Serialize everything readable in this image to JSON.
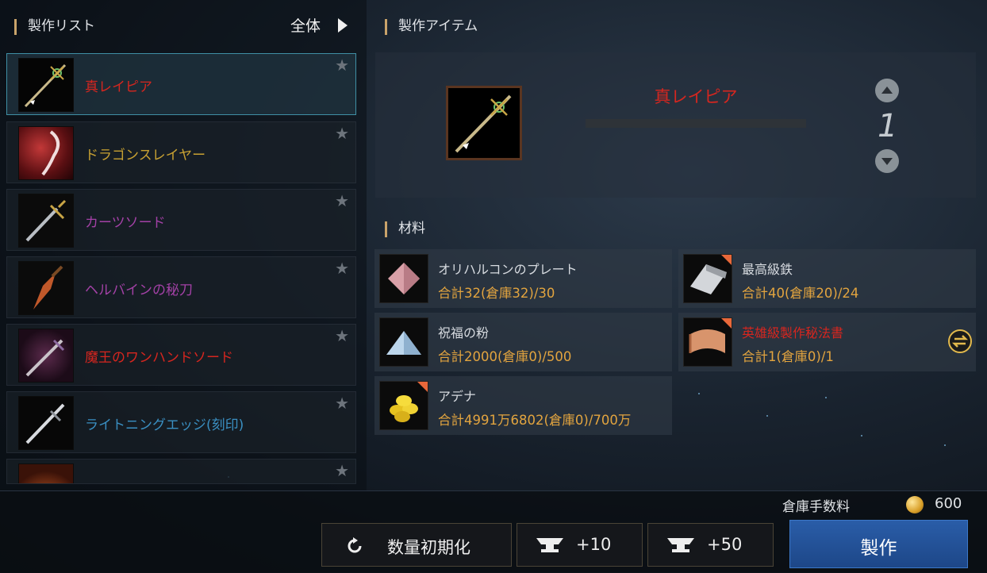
{
  "craft_list": {
    "title": "製作リスト",
    "filter": "全体",
    "items": [
      {
        "name": "真レイピア",
        "color": "#d6261f",
        "selected": true
      },
      {
        "name": "ドラゴンスレイヤー",
        "color": "#c8a132"
      },
      {
        "name": "カーツソード",
        "color": "#a341a6"
      },
      {
        "name": "ヘルバインの秘刀",
        "color": "#a341a6"
      },
      {
        "name": "魔王のワンハンドソード",
        "color": "#d6261f"
      },
      {
        "name": "ライトニングエッジ(刻印)",
        "color": "#3a8fc2"
      },
      {
        "name": "",
        "color": "#d6261f"
      }
    ]
  },
  "craft_item": {
    "title": "製作アイテム",
    "name": "真レイピア",
    "quantity": "1"
  },
  "materials": {
    "title": "材料",
    "items": [
      {
        "name": "オリハルコンのプレート",
        "count": "合計32(倉庫32)/30",
        "name_color": "#d7dbe0"
      },
      {
        "name": "最高級鉄",
        "count": "合計40(倉庫20)/24",
        "name_color": "#d7dbe0"
      },
      {
        "name": "祝福の粉",
        "count": "合計2000(倉庫0)/500",
        "name_color": "#d7dbe0"
      },
      {
        "name": "英雄級製作秘法書",
        "count": "合計1(倉庫0)/1",
        "name_color": "#d6261f"
      },
      {
        "name": "アデナ",
        "count": "合計4991万6802(倉庫0)/700万",
        "name_color": "#d7dbe0"
      }
    ]
  },
  "footer": {
    "fee_label": "倉庫手数料",
    "fee_value": "600",
    "reset_label": "数量初期化",
    "plus10_label": "+10",
    "plus50_label": "+50",
    "craft_label": "製作"
  }
}
